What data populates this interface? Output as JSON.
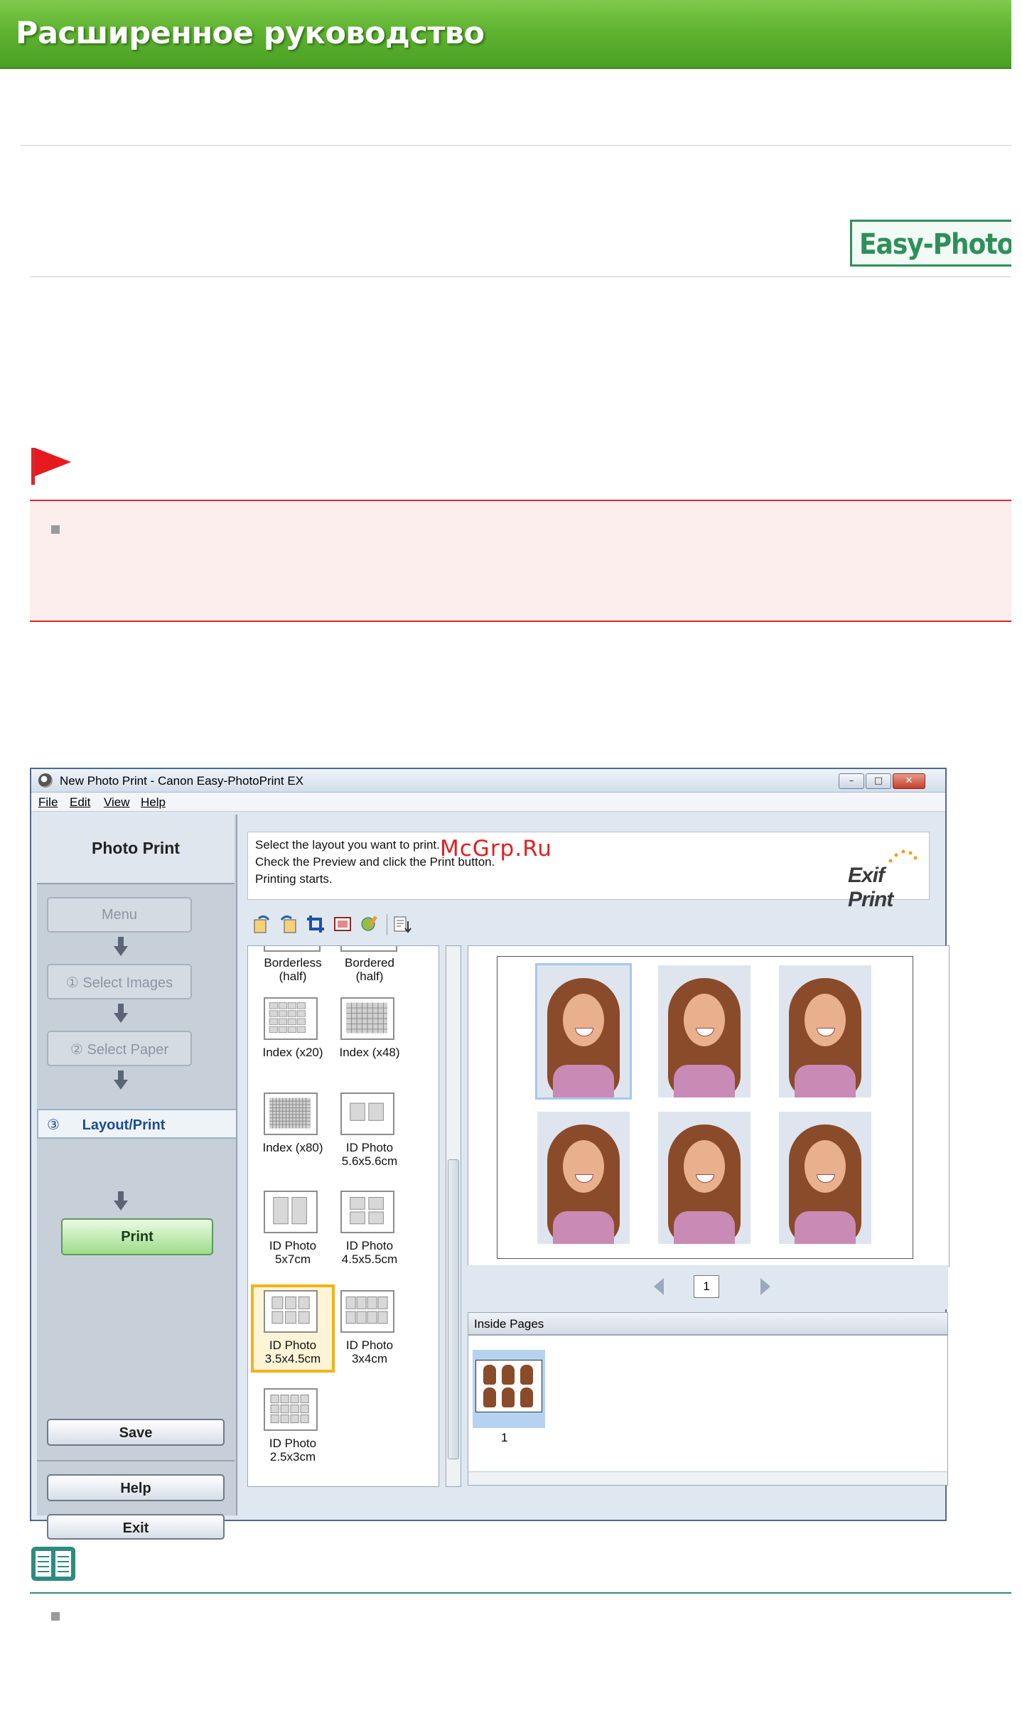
{
  "page": {
    "banner_title": "Расширенное руководство",
    "logo_text": "Easy-PhotoP"
  },
  "window": {
    "title": "New Photo Print - Canon Easy-PhotoPrint EX",
    "controls": {
      "minimize": "–",
      "maximize": "□",
      "close": "✕"
    },
    "menu": [
      "File",
      "Edit",
      "View",
      "Help"
    ],
    "sidebar": {
      "section_label": "Photo Print",
      "steps": [
        {
          "label": "Menu"
        },
        {
          "label": "① Select Images"
        },
        {
          "label": "② Select Paper"
        }
      ],
      "active_step": {
        "number": "③",
        "label": "Layout/Print"
      },
      "print_button": "Print",
      "save_button": "Save",
      "help_button": "Help",
      "exit_button": "Exit"
    },
    "instructions": [
      "Select the layout you want to print.",
      "Check the Preview and click the Print button.",
      "Printing starts."
    ],
    "exif_logo": "Exif Print",
    "watermark": "McGrp.Ru",
    "layouts": [
      {
        "label": "Borderless (half)"
      },
      {
        "label": "Bordered (half)"
      },
      {
        "label": "Index (x20)"
      },
      {
        "label": "Index (x48)"
      },
      {
        "label": "Index (x80)"
      },
      {
        "label": "ID Photo 5.6x5.6cm"
      },
      {
        "label": "ID Photo 5x7cm"
      },
      {
        "label": "ID Photo 4.5x5.5cm"
      },
      {
        "label": "ID Photo 3.5x4.5cm",
        "selected": true
      },
      {
        "label": "ID Photo 3x4cm"
      },
      {
        "label": "ID Photo 2.5x3cm"
      }
    ],
    "layout_label_lines": [
      [
        "Borderless",
        "(half)"
      ],
      [
        "Bordered",
        "(half)"
      ],
      [
        "Index (x20)"
      ],
      [
        "Index (x48)"
      ],
      [
        "Index (x80)"
      ],
      [
        "ID Photo",
        "5.6x5.6cm"
      ],
      [
        "ID Photo",
        "5x7cm"
      ],
      [
        "ID Photo",
        "4.5x5.5cm"
      ],
      [
        "ID Photo",
        "3.5x4.5cm"
      ],
      [
        "ID Photo",
        "3x4cm"
      ],
      [
        "ID Photo",
        "2.5x3cm"
      ]
    ],
    "page_number": "1",
    "inside_pages_label": "Inside Pages",
    "inside_page_thumb_number": "1",
    "toolbar_icons": [
      "rotate-left-icon",
      "rotate-right-icon",
      "crop-icon",
      "frame-icon",
      "correct-image-icon",
      "date-settings-icon"
    ],
    "colors": {
      "banner_green": "#5fb431",
      "caution_red": "#d9262c",
      "selected_layout": "#f3b21a",
      "print_button_green": "#9edc8a"
    }
  }
}
